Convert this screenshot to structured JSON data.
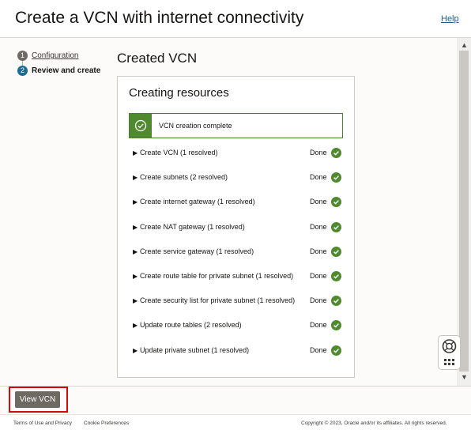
{
  "header": {
    "title": "Create a VCN with internet connectivity",
    "help_label": "Help"
  },
  "steps": [
    {
      "number": "1",
      "label": "Configuration"
    },
    {
      "number": "2",
      "label": "Review and create"
    }
  ],
  "content": {
    "title": "Created VCN",
    "card_title": "Creating resources",
    "banner_text": "VCN creation complete",
    "rows": [
      {
        "label": "Create VCN (1 resolved)",
        "status": "Done"
      },
      {
        "label": "Create subnets (2 resolved)",
        "status": "Done"
      },
      {
        "label": "Create internet gateway (1 resolved)",
        "status": "Done"
      },
      {
        "label": "Create NAT gateway (1 resolved)",
        "status": "Done"
      },
      {
        "label": "Create service gateway (1 resolved)",
        "status": "Done"
      },
      {
        "label": "Create route table for private subnet (1 resolved)",
        "status": "Done"
      },
      {
        "label": "Create security list for private subnet (1 resolved)",
        "status": "Done"
      },
      {
        "label": "Update route tables (2 resolved)",
        "status": "Done"
      },
      {
        "label": "Update private subnet (1 resolved)",
        "status": "Done"
      }
    ]
  },
  "footer": {
    "view_button": "View VCN",
    "terms": "Terms of Use and Privacy",
    "cookies": "Cookie Preferences",
    "copyright": "Copyright © 2023, Oracle and/or its affiliates. All rights reserved."
  },
  "colors": {
    "success": "#4f8a2e",
    "highlight": "#d40a0a",
    "link": "#1a5e9c"
  }
}
